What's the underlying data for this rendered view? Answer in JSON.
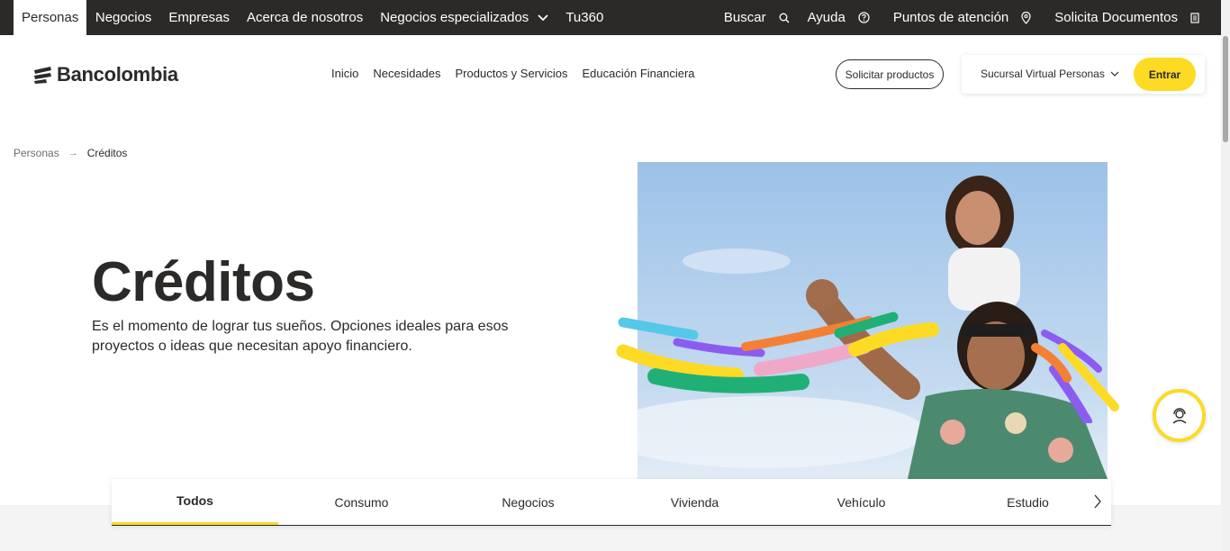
{
  "topbar": {
    "items": [
      "Personas",
      "Negocios",
      "Empresas",
      "Acerca de nosotros",
      "Negocios especializados",
      "Tu360"
    ],
    "active_index": 0,
    "right": [
      {
        "label": "Buscar",
        "icon": "search-icon"
      },
      {
        "label": "Ayuda",
        "icon": "help-icon"
      },
      {
        "label": "Puntos de atención",
        "icon": "location-pin-icon"
      },
      {
        "label": "Solicita Documentos",
        "icon": "document-icon"
      }
    ]
  },
  "header": {
    "brand": "Bancolombia",
    "nav": [
      "Inicio",
      "Necesidades",
      "Productos y Servicios",
      "Educación Financiera"
    ],
    "solicitar_label": "Solicitar productos",
    "sucursal_label": "Sucursal Virtual Personas",
    "entrar_label": "Entrar"
  },
  "breadcrumb": {
    "parent": "Personas",
    "current": "Créditos"
  },
  "hero": {
    "title": "Créditos",
    "description": "Es el momento de lograr tus sueños. Opciones ideales para esos proyectos o ideas que necesitan apoyo financiero."
  },
  "tabs": {
    "items": [
      "Todos",
      "Consumo",
      "Negocios",
      "Vivienda",
      "Vehículo",
      "Estudio"
    ],
    "active_index": 0
  },
  "colors": {
    "brand_yellow": "#fdda24",
    "dark": "#2c2a29"
  }
}
